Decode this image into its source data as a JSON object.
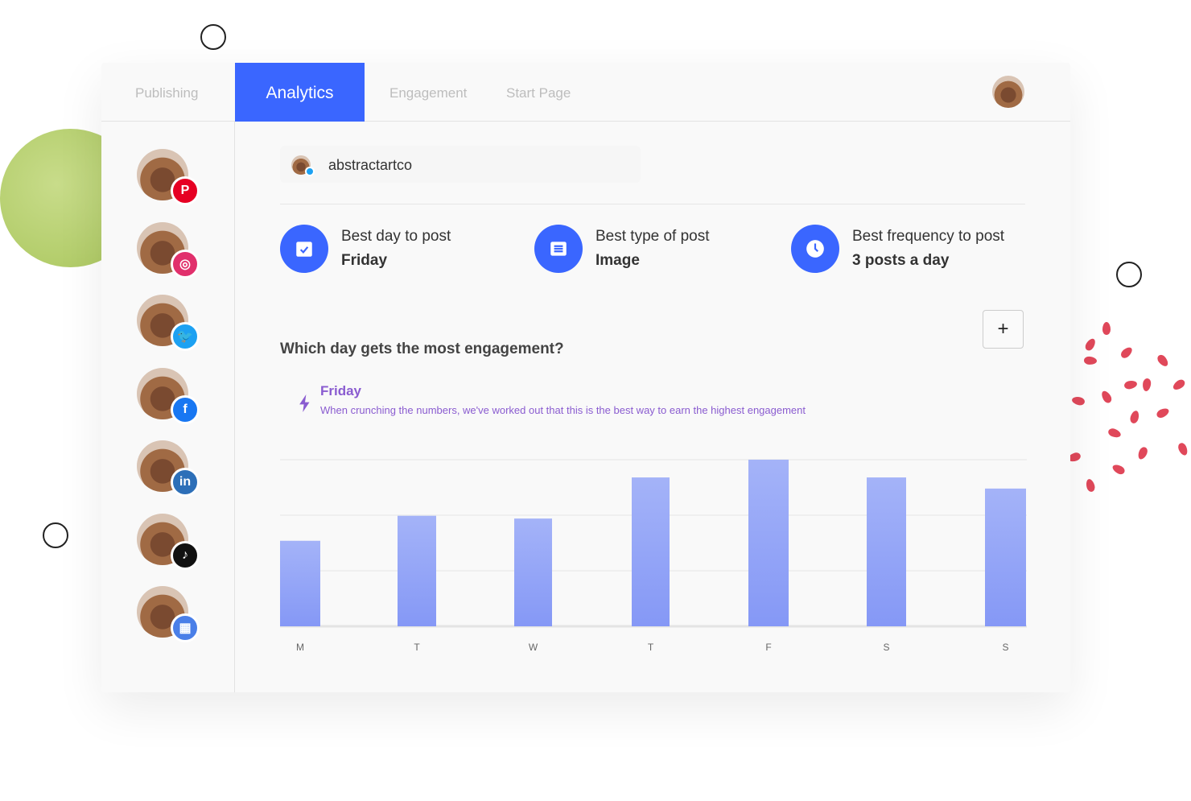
{
  "nav": {
    "tabs": [
      {
        "label": "Publishing"
      },
      {
        "label": "Analytics",
        "active": true
      },
      {
        "label": "Engagement"
      },
      {
        "label": "Start Page"
      }
    ]
  },
  "sidebar": {
    "channels": [
      {
        "network": "pinterest",
        "color": "#e60023",
        "glyph": "P"
      },
      {
        "network": "instagram",
        "color": "#e1306c",
        "glyph": "◎"
      },
      {
        "network": "twitter",
        "color": "#1da1f2",
        "glyph": "🐦"
      },
      {
        "network": "facebook",
        "color": "#1877f2",
        "glyph": "f"
      },
      {
        "network": "linkedin",
        "color": "#2d6fb8",
        "glyph": "in"
      },
      {
        "network": "tiktok",
        "color": "#111111",
        "glyph": "♪"
      },
      {
        "network": "google-business",
        "color": "#4a7fe8",
        "glyph": "▦"
      }
    ]
  },
  "account": {
    "name": "abstractartco",
    "network": "twitter"
  },
  "stats": [
    {
      "label": "Best day to post",
      "value": "Friday",
      "icon": "calendar-icon"
    },
    {
      "label": "Best type of post",
      "value": "Image",
      "icon": "document-icon"
    },
    {
      "label": "Best frequency to post",
      "value": "3 posts a day",
      "icon": "clock-icon"
    }
  ],
  "question": "Which day gets the most engagement?",
  "add_label": "+",
  "highlight": {
    "title": "Friday",
    "description": "When crunching the numbers, we've worked out that this is the best way to earn the highest engagement"
  },
  "colors": {
    "accent": "#3a66ff",
    "highlight": "#8a5cd0",
    "bar": "#94a8f8"
  },
  "chart_data": {
    "type": "bar",
    "categories": [
      "M",
      "T",
      "W",
      "T",
      "F",
      "S",
      "S"
    ],
    "values": [
      1.54,
      1.99,
      1.94,
      2.68,
      3.0,
      2.68,
      2.48
    ],
    "ylim": [
      0,
      3
    ],
    "grid": true,
    "title": "",
    "xlabel": "",
    "ylabel": ""
  }
}
